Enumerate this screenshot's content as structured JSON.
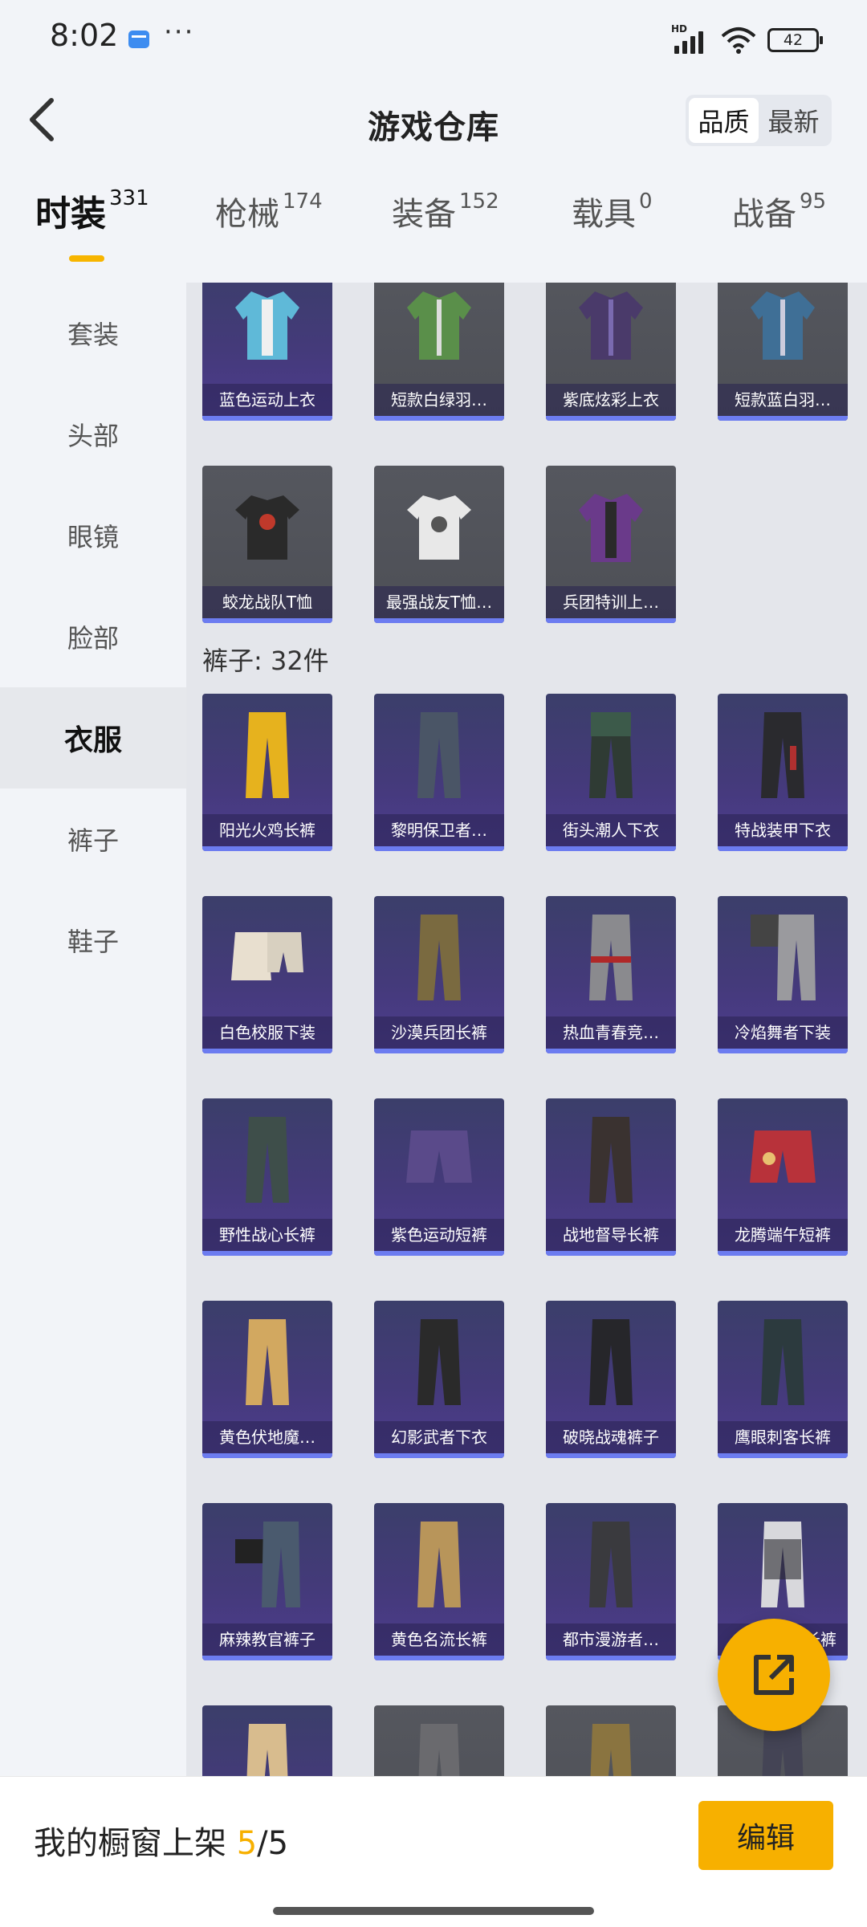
{
  "status": {
    "time": "8:02",
    "more": "···",
    "battery": "42",
    "signal_tag": "HD"
  },
  "header": {
    "title": "游戏仓库",
    "sort": [
      "品质",
      "最新"
    ]
  },
  "tabs": [
    {
      "label": "时装",
      "count": "331"
    },
    {
      "label": "枪械",
      "count": "174"
    },
    {
      "label": "装备",
      "count": "152"
    },
    {
      "label": "载具",
      "count": "0"
    },
    {
      "label": "战备",
      "count": "95"
    }
  ],
  "sidebar": [
    "套装",
    "头部",
    "眼镜",
    "脸部",
    "衣服",
    "裤子",
    "鞋子"
  ],
  "tops": [
    "蓝色运动上衣",
    "短款白绿羽…",
    "紫底炫彩上衣",
    "短款蓝白羽…",
    "蛟龙战队T恤",
    "最强战友T恤…",
    "兵团特训上…"
  ],
  "pants_header": "裤子: 32件",
  "pants": [
    "阳光火鸡长裤",
    "黎明保卫者…",
    "街头潮人下衣",
    "特战装甲下衣",
    "白色校服下装",
    "沙漠兵团长裤",
    "热血青春竞…",
    "冷焰舞者下装",
    "野性战心长裤",
    "紫色运动短裤",
    "战地督导长裤",
    "龙腾端午短裤",
    "黄色伏地魔…",
    "幻影武者下衣",
    "破晓战魂裤子",
    "鹰眼刺客长裤",
    "麻辣教官裤子",
    "黄色名流长裤",
    "都市漫游者…",
    "长裤"
  ],
  "bottom": {
    "label": "我的橱窗上架 ",
    "count": "5",
    "total": "/5",
    "edit": "编辑"
  },
  "colors": {
    "accent": "#f7b000",
    "card_purple": "#443a7a",
    "card_grey": "#55575e"
  }
}
